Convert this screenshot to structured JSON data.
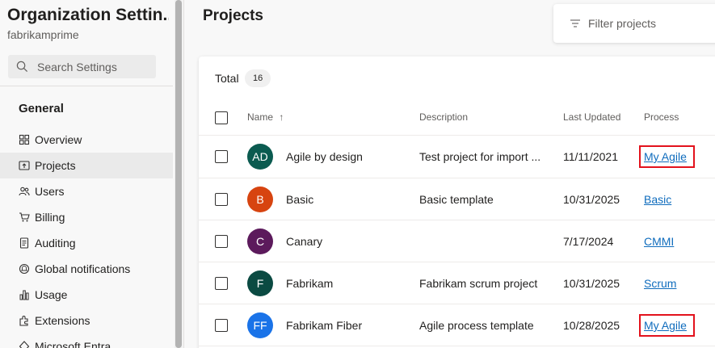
{
  "sidebar": {
    "org_title": "Organization Settin...",
    "org_name": "fabrikamprime",
    "search_placeholder": "Search Settings",
    "section": "General",
    "items": [
      {
        "label": "Overview",
        "icon": "overview-icon"
      },
      {
        "label": "Projects",
        "icon": "projects-icon",
        "selected": true
      },
      {
        "label": "Users",
        "icon": "users-icon"
      },
      {
        "label": "Billing",
        "icon": "billing-icon"
      },
      {
        "label": "Auditing",
        "icon": "auditing-icon"
      },
      {
        "label": "Global notifications",
        "icon": "notifications-icon"
      },
      {
        "label": "Usage",
        "icon": "usage-icon"
      },
      {
        "label": "Extensions",
        "icon": "extensions-icon"
      },
      {
        "label": "Microsoft Entra",
        "icon": "entra-icon"
      }
    ]
  },
  "main": {
    "title": "Projects",
    "filter_placeholder": "Filter projects",
    "total_label": "Total",
    "total_count": "16",
    "columns": {
      "name": "Name",
      "sort": "↑",
      "description": "Description",
      "last_updated": "Last Updated",
      "process": "Process"
    },
    "rows": [
      {
        "initials": "AD",
        "color": "#0b5b50",
        "name": "Agile by design",
        "description": "Test project for import ...",
        "updated": "11/11/2021",
        "process": "My Agile",
        "highlight": true
      },
      {
        "initials": "B",
        "color": "#d74410",
        "name": "Basic",
        "description": "Basic template",
        "updated": "10/31/2025",
        "process": "Basic",
        "highlight": false
      },
      {
        "initials": "C",
        "color": "#5c1a5c",
        "name": "Canary",
        "description": "",
        "updated": "7/17/2024",
        "process": "CMMI",
        "highlight": false
      },
      {
        "initials": "F",
        "color": "#0b4a42",
        "name": "Fabrikam",
        "description": "Fabrikam scrum project",
        "updated": "10/31/2025",
        "process": "Scrum",
        "highlight": false
      },
      {
        "initials": "FF",
        "color": "#1a73e8",
        "name": "Fabrikam Fiber",
        "description": "Agile process template",
        "updated": "10/28/2025",
        "process": "My Agile",
        "highlight": true
      }
    ]
  }
}
